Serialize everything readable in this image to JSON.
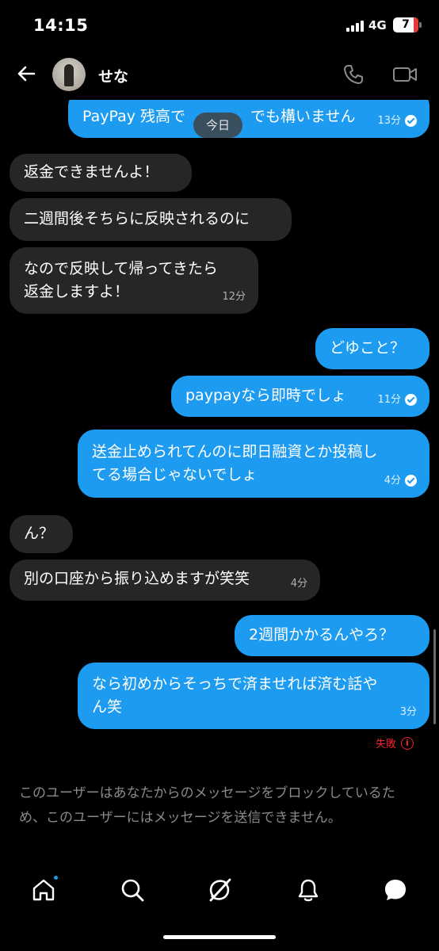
{
  "status_bar": {
    "time": "14:15",
    "network": "4G",
    "battery": "7"
  },
  "header": {
    "contact_name": "せな"
  },
  "chat": {
    "partial_top": {
      "text": "PayPay 残高で　 　　　でも構いません",
      "time": "13分"
    },
    "date_chip": "今日",
    "incoming_1": [
      {
        "text": "返金できませんよ！"
      },
      {
        "text": "二週間後そちらに反映されるのに"
      },
      {
        "line1": "なので反映して帰ってきたら",
        "line2": "返金しますよ！",
        "time": "12分"
      }
    ],
    "outgoing_1": [
      {
        "text": "どゆこと？"
      },
      {
        "text": "paypayなら即時でしょ",
        "time": "11分"
      },
      {
        "line1": "送金止められてんのに即日融資とか投稿し",
        "line2": "てる場合じゃないでしょ",
        "time": "4分"
      }
    ],
    "incoming_2": [
      {
        "text": "ん？"
      },
      {
        "text": "別の口座から振り込めますが笑笑",
        "time": "4分"
      }
    ],
    "outgoing_2": [
      {
        "text": "2週間かかるんやろ？"
      },
      {
        "line1": "なら初めからそっちで済ませれば済む話や",
        "line2": "ん笑",
        "time": "3分"
      }
    ],
    "failed_label": "失敗"
  },
  "blocked_notice": "このユーザーはあなたからのメッセージをブロックしているため、このユーザーにはメッセージを送信できません。",
  "nav": [
    "home-icon",
    "search-icon",
    "grok-icon",
    "notifications-icon",
    "messages-icon"
  ]
}
